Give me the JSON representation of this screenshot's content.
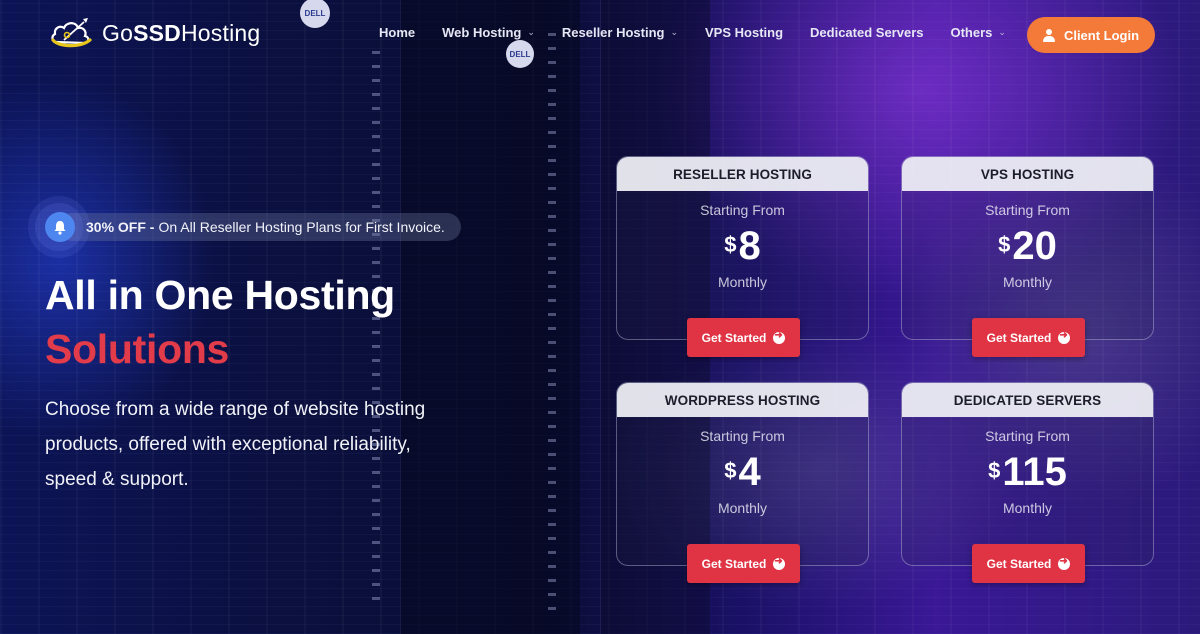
{
  "brand": {
    "name_regular_1": "Go",
    "name_bold": "SSD",
    "name_regular_2": "Hosting",
    "logo_icon": "cloud-rocket-icon"
  },
  "nav": {
    "items": [
      {
        "label": "Home",
        "has_dropdown": false
      },
      {
        "label": "Web Hosting",
        "has_dropdown": true
      },
      {
        "label": "Reseller Hosting",
        "has_dropdown": true
      },
      {
        "label": "VPS Hosting",
        "has_dropdown": false
      },
      {
        "label": "Dedicated Servers",
        "has_dropdown": false
      },
      {
        "label": "Others",
        "has_dropdown": true
      }
    ],
    "dropdown_glyph": "⌄",
    "login_label": "Client Login"
  },
  "promo": {
    "highlight": "30% OFF -",
    "text": "On All Reseller Hosting Plans for First Invoice.",
    "icon": "bell-icon"
  },
  "hero": {
    "title_line1": "All in One Hosting",
    "title_line2": "Solutions",
    "description": "Choose from a wide range of website hosting products, offered with exceptional reliability, speed & support."
  },
  "plans": [
    {
      "name": "RESELLER HOSTING",
      "from_label": "Starting From",
      "currency": "$",
      "price": "8",
      "period": "Monthly",
      "cta": "Get Started"
    },
    {
      "name": "VPS HOSTING",
      "from_label": "Starting From",
      "currency": "$",
      "price": "20",
      "period": "Monthly",
      "cta": "Get Started"
    },
    {
      "name": "WORDPRESS HOSTING",
      "from_label": "Starting From",
      "currency": "$",
      "price": "4",
      "period": "Monthly",
      "cta": "Get Started"
    },
    {
      "name": "DEDICATED SERVERS",
      "from_label": "Starting From",
      "currency": "$",
      "price": "115",
      "period": "Monthly",
      "cta": "Get Started"
    }
  ],
  "colors": {
    "accent_red": "#e03444",
    "login_orange": "#f47a3a",
    "promo_blue": "#4e86f0",
    "logo_yellow": "#e8c61c"
  }
}
